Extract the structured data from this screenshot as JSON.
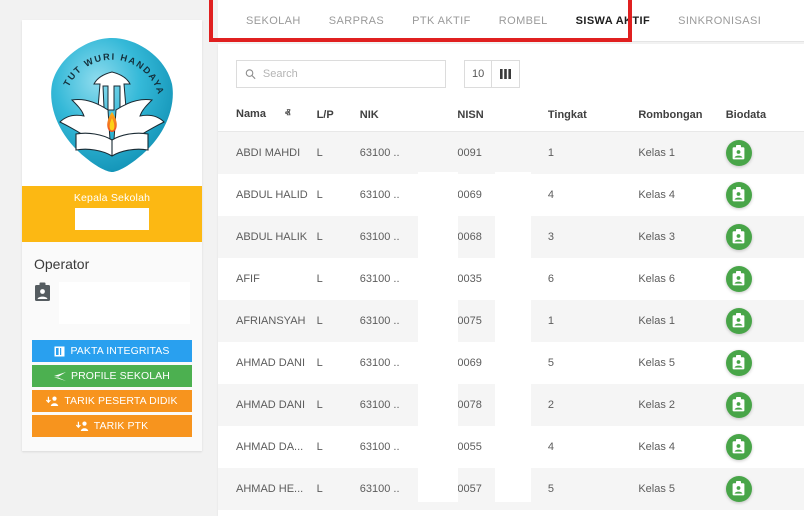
{
  "sidebar": {
    "logo": {
      "icon": "tut-wuri-handayani-logo",
      "motto": "TUT WURI HANDAYANI",
      "shield_color": "#2cb6d4",
      "flame_color": "#f26722"
    },
    "kepala_sekolah": {
      "label": "Kepala Sekolah",
      "value_redacted": "",
      "panel_color": "#fcb813"
    },
    "operator": {
      "title": "Operator",
      "icon": "id-card-icon",
      "value_redacted": ""
    },
    "buttons": [
      {
        "label": "PAKTA INTEGRITAS",
        "color": "#29a0ef",
        "icon": "book-icon"
      },
      {
        "label": "PROFILE SEKOLAH",
        "color": "#4cb050",
        "icon": "paper-plane-icon"
      },
      {
        "label": "TARIK PESERTA DIDIK",
        "color": "#f7941e",
        "icon": "user-download-icon"
      },
      {
        "label": "TARIK PTK",
        "color": "#f7941e",
        "icon": "user-download-icon"
      }
    ]
  },
  "tabs": [
    {
      "label": "SEKOLAH",
      "active": false
    },
    {
      "label": "SARPRAS",
      "active": false
    },
    {
      "label": "PTK AKTIF",
      "active": false
    },
    {
      "label": "ROMBEL",
      "active": false
    },
    {
      "label": "SISWA AKTIF",
      "active": true
    },
    {
      "label": "SINKRONISASI",
      "active": false
    }
  ],
  "annotation": {
    "type": "rectangle-highlight",
    "color": "#e02020",
    "target": "tab-bar"
  },
  "toolbar": {
    "search": {
      "icon": "search-icon",
      "placeholder": "Search",
      "value": ""
    },
    "page_size": "10",
    "columns_button_icon": "columns-icon"
  },
  "table": {
    "columns": [
      "Nama",
      "L/P",
      "NIK",
      "NISN",
      "Tingkat",
      "Rombongan",
      "Biodata"
    ],
    "sort": {
      "column": "Nama",
      "direction": "asc",
      "caret": "ⱏ"
    },
    "biodata_icon": "id-card-icon",
    "biodata_color": "#48a548",
    "redacted_note": "NIK and NISN digits partially covered by white blocks",
    "rows": [
      {
        "nama": "ABDI MAHDI",
        "lp": "L",
        "nik": "63100",
        "nik_suffix": "..",
        "nisn": "0091",
        "tingkat": "1",
        "rombongan": "Kelas 1"
      },
      {
        "nama": "ABDUL HALID",
        "lp": "L",
        "nik": "63100",
        "nik_suffix": "..",
        "nisn": "0069",
        "tingkat": "4",
        "rombongan": "Kelas 4"
      },
      {
        "nama": "ABDUL HALIK",
        "lp": "L",
        "nik": "63100",
        "nik_suffix": "..",
        "nisn": "0068",
        "tingkat": "3",
        "rombongan": "Kelas 3"
      },
      {
        "nama": "AFIF",
        "lp": "L",
        "nik": "63100",
        "nik_suffix": "..",
        "nisn": "0035",
        "tingkat": "6",
        "rombongan": "Kelas 6"
      },
      {
        "nama": "AFRIANSYAH",
        "lp": "L",
        "nik": "63100",
        "nik_suffix": "..",
        "nisn": "0075",
        "tingkat": "1",
        "rombongan": "Kelas 1"
      },
      {
        "nama": "AHMAD DANI",
        "lp": "L",
        "nik": "63100",
        "nik_suffix": "..",
        "nisn": "0069",
        "tingkat": "5",
        "rombongan": "Kelas 5"
      },
      {
        "nama": "AHMAD DANI",
        "lp": "L",
        "nik": "63100",
        "nik_suffix": "..",
        "nisn": "0078",
        "tingkat": "2",
        "rombongan": "Kelas 2"
      },
      {
        "nama": "AHMAD DA...",
        "lp": "L",
        "nik": "63100",
        "nik_suffix": "..",
        "nisn": "0055",
        "tingkat": "4",
        "rombongan": "Kelas 4"
      },
      {
        "nama": "AHMAD HE...",
        "lp": "L",
        "nik": "63100",
        "nik_suffix": "..",
        "nisn": "0057",
        "tingkat": "5",
        "rombongan": "Kelas 5"
      }
    ]
  }
}
